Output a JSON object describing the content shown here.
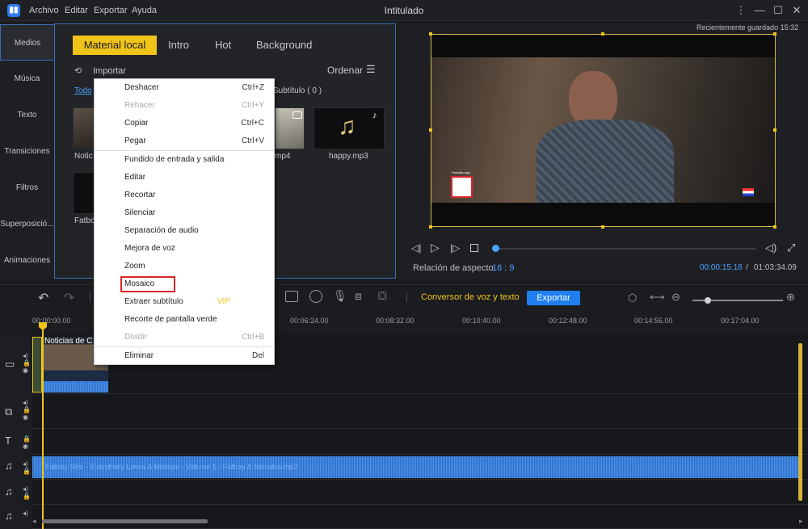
{
  "window": {
    "title": "Intitulado",
    "menu": [
      "Archivo",
      "Editar",
      "Exportar",
      "Ayuda"
    ],
    "saved_status": "Recientemente guardado 15:32"
  },
  "sidebar": {
    "items": [
      {
        "label": "Medios"
      },
      {
        "label": "Música"
      },
      {
        "label": "Texto"
      },
      {
        "label": "Transiciones"
      },
      {
        "label": "Filtros"
      },
      {
        "label": "Superposició..."
      },
      {
        "label": "Animaciones"
      }
    ]
  },
  "media": {
    "tabs": [
      "Material local",
      "Intro",
      "Hot",
      "Background"
    ],
    "import_label": "Importar",
    "sort_label": "Ordenar",
    "filters": [
      "Todo",
      "Subtítulo ( 0 )"
    ],
    "items": [
      {
        "label": "Notic"
      },
      {
        "label": "mp4"
      },
      {
        "label": "happy.mp3"
      },
      {
        "label": "Fatbo"
      }
    ]
  },
  "context_menu": {
    "items": [
      {
        "label": "Deshacer",
        "shortcut": "Ctrl+Z",
        "enabled": true
      },
      {
        "label": "Rehacer",
        "shortcut": "Ctrl+Y",
        "enabled": false
      },
      {
        "label": "Copiar",
        "shortcut": "Ctrl+C",
        "enabled": true
      },
      {
        "label": "Pegar",
        "shortcut": "Ctrl+V",
        "enabled": true
      },
      {
        "label": "Fundido de entrada y salida",
        "shortcut": "",
        "enabled": true
      },
      {
        "label": "Editar",
        "shortcut": "",
        "enabled": true
      },
      {
        "label": "Recortar",
        "shortcut": "",
        "enabled": true
      },
      {
        "label": "Silenciar",
        "shortcut": "",
        "enabled": true
      },
      {
        "label": "Separación de audio",
        "shortcut": "",
        "enabled": true
      },
      {
        "label": "Mejora de voz",
        "shortcut": "",
        "enabled": true
      },
      {
        "label": "Zoom",
        "shortcut": "",
        "enabled": true
      },
      {
        "label": "Mosaico",
        "shortcut": "",
        "enabled": true,
        "highlighted": true
      },
      {
        "label": "Extraer subtítulo",
        "shortcut": "VIP",
        "enabled": true
      },
      {
        "label": "Recorte de pantalla verde",
        "shortcut": "",
        "enabled": true
      },
      {
        "label": "Dividir",
        "shortcut": "Ctrl+B",
        "enabled": false
      },
      {
        "label": "Eliminar",
        "shortcut": "Del",
        "enabled": true
      }
    ]
  },
  "preview": {
    "aspect_label": "Relación de aspecto",
    "aspect_value": "16 : 9",
    "current_time": "00:00:15.18",
    "separator": "/",
    "total_time": "01:03:34.09",
    "progress": 0.004,
    "video_overlay_text": "Pantalla aquí"
  },
  "toolbar": {
    "voice_text_label": "Conversor de voz y texto",
    "export_label": "Exportar"
  },
  "timeline": {
    "ticks": [
      "00:00:00.00",
      "00:06:24.00",
      "00:08:32.00",
      "00:10:40.00",
      "00:12:48.00",
      "00:14:56.00",
      "00:17:04.00"
    ],
    "video_clip_title": "Noticias de C",
    "audio_clip_title": "Fatboy Slim - Everybody Loves A Mixtape - Volume 1 - Fatboy & Slovakia.mp3"
  },
  "colors": {
    "accent_yellow": "#f0c419",
    "export_blue": "#1f7ff0",
    "time_blue": "#4aa3ff",
    "highlight_red": "#d9262a"
  }
}
